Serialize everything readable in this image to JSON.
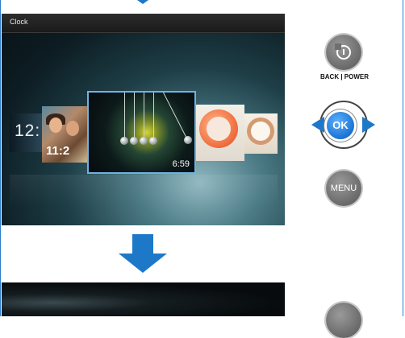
{
  "screen": {
    "title": "Clock",
    "carousel": [
      {
        "name": "thumb-digital-clock",
        "label": "12:"
      },
      {
        "name": "thumb-photo-clock",
        "label": "11:2"
      },
      {
        "name": "thumb-pendulum-clock",
        "label": "6:59",
        "selected": true
      },
      {
        "name": "thumb-orange-clock",
        "label": ""
      },
      {
        "name": "thumb-peach-clock",
        "label": ""
      }
    ]
  },
  "controls": {
    "back_label": "BACK | POWER",
    "ok_label": "OK",
    "menu_label": "MENU",
    "icons": [
      "back-power-icon",
      "left-arrow-icon",
      "right-arrow-icon"
    ]
  },
  "colors": {
    "accent": "#1e78c8",
    "button_gray": "#707070"
  }
}
